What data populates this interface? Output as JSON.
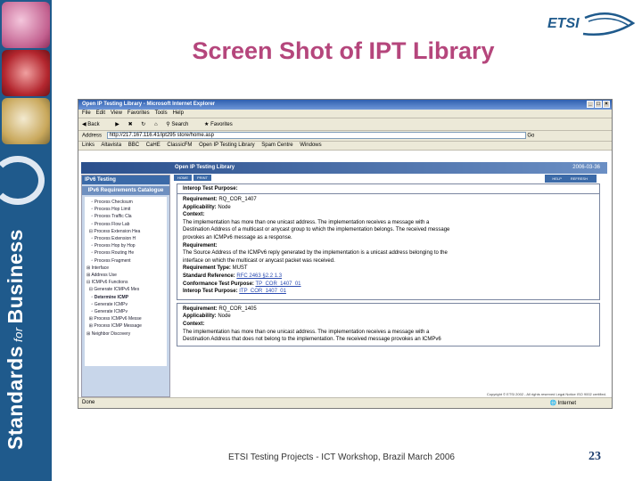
{
  "slide": {
    "title": "Screen Shot of IPT Library",
    "sidebar_text_1": "Standards",
    "sidebar_text_2": "for",
    "sidebar_text_3": "Business",
    "footer": "ETSI Testing Projects - ICT Workshop, Brazil March 2006",
    "page_number": "23",
    "logo_text": "ETSI"
  },
  "browser": {
    "window_title": "Open IP Testing Library - Microsoft Internet Explorer",
    "menu": [
      "File",
      "Edit",
      "View",
      "Favorites",
      "Tools",
      "Help"
    ],
    "toolbar": [
      "Back",
      "Search",
      "Favorites"
    ],
    "address_label": "Address",
    "address": "http://217.167.116.41/ipt295 store/home.asp",
    "go_label": "Go",
    "links_label": "Links",
    "links": [
      "Altavista",
      "BBC",
      "CaHE",
      "ClassicFM",
      "Open IP Testing Library",
      "Spam Centre",
      "Windows"
    ],
    "status": "Done",
    "zone": "Internet",
    "copyright": "Copyright © ETSI 2002 - All rights reserved  Legal Notice  ISO 9002 certified."
  },
  "app": {
    "header_title": "Open IP Testing Library",
    "date": "2006-03-36",
    "left_panel": {
      "heading": "IPv6 Testing",
      "subheading": "IPv6 Requirements Catalogue",
      "tree": [
        "Process Checksum",
        "Process Hop Limit",
        "Process Traffic Cla",
        "Process Flow Lab",
        "Process Extension Hea",
        "Process Extension H",
        "Process Hop by Hop",
        "Process Routing He",
        "Process Fragment",
        "Interface",
        "Address Use",
        "ICMPv6 Functions",
        "Generate ICMPv6 Mes",
        "Determine ICMP",
        "Generate ICMPv",
        "Generate ICMPv",
        "Process ICMPv6 Messe",
        "Process ICMP Message",
        "Neighbor Discovery"
      ]
    },
    "buttons_left": [
      "HOME",
      "PRINT"
    ],
    "buttons_right": [
      "HELP",
      "REFRESH"
    ],
    "panel1": {
      "heading": "Interop Test Purpose:",
      "req_label": "Requirement:",
      "req_value": "RQ_COR_1407",
      "appl_label": "Applicability:",
      "appl_value": "Node",
      "context_label": "Context:",
      "context_text_1": "The implementation has more than one unicast address. The implementation receives a message with a",
      "context_text_2": "Destination Address of a multicast or anycast group to which the implementation belongs. The received message",
      "context_text_3": "provokes an ICMPv6 message as a response.",
      "requirement_label": "Requirement:",
      "requirement_text_1": "The Source Address of the ICMPv6 reply generated by the implementation is a unicast address belonging to the",
      "requirement_text_2": "interface on which the multicast or anycast packet was received.",
      "reqtype_label": "Requirement Type:",
      "reqtype_value": "MUST",
      "stdref_label": "Standard Reference:",
      "stdref_value": "RFC 2463 §2.2 1.3",
      "ctp_label": "Conformance Test Purpose:",
      "ctp_value": "TP_COR_1407_01",
      "itp_label": "Interop Test Purpose:",
      "itp_value": "ITP_COR_1407_01"
    },
    "panel2": {
      "req_label": "Requirement:",
      "req_value": "RQ_COR_1405",
      "appl_label": "Applicability:",
      "appl_value": "Node",
      "context_label": "Context:",
      "context_text_1": "The implementation has more than one unicast address. The implementation receives a message with a",
      "context_text_2": "Destination Address that does not belong to the implementation. The received message provokes an ICMPv6"
    }
  },
  "colors": {
    "title": "#b5467c",
    "sidebar": "#1f5a8c",
    "ie_titlebar": "#2e5fb0",
    "app_header": "#2a4f8c"
  }
}
